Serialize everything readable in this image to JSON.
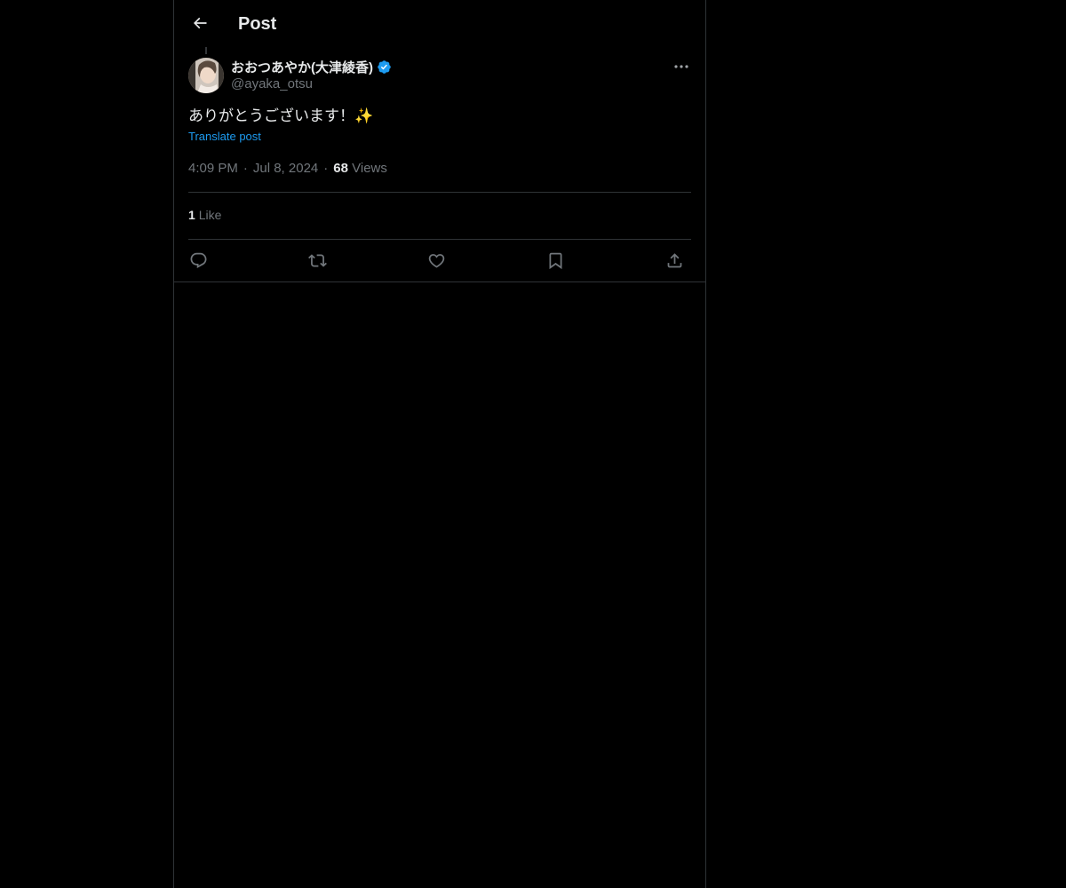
{
  "header": {
    "title": "Post",
    "back_icon": "arrow-left-icon"
  },
  "author": {
    "display_name": "おおつあやか(大津綾香)",
    "handle": "@ayaka_otsu",
    "verified": true,
    "verified_color": "#1d9bf0"
  },
  "post": {
    "text": "ありがとうございます！✨",
    "translate_label": "Translate post",
    "time": "4:09 PM",
    "separator": "·",
    "date": "Jul 8, 2024",
    "views_count": "68",
    "views_label": "Views"
  },
  "engagement": {
    "likes_count": "1",
    "likes_label": "Like"
  },
  "actions": [
    {
      "name": "reply",
      "icon": "reply-icon"
    },
    {
      "name": "repost",
      "icon": "repost-icon"
    },
    {
      "name": "like",
      "icon": "heart-icon"
    },
    {
      "name": "bookmark",
      "icon": "bookmark-icon"
    },
    {
      "name": "share",
      "icon": "share-icon"
    }
  ],
  "colors": {
    "background": "#000000",
    "text_primary": "#e7e9ea",
    "text_secondary": "#71767b",
    "accent": "#1d9bf0",
    "border": "#2f3336"
  }
}
